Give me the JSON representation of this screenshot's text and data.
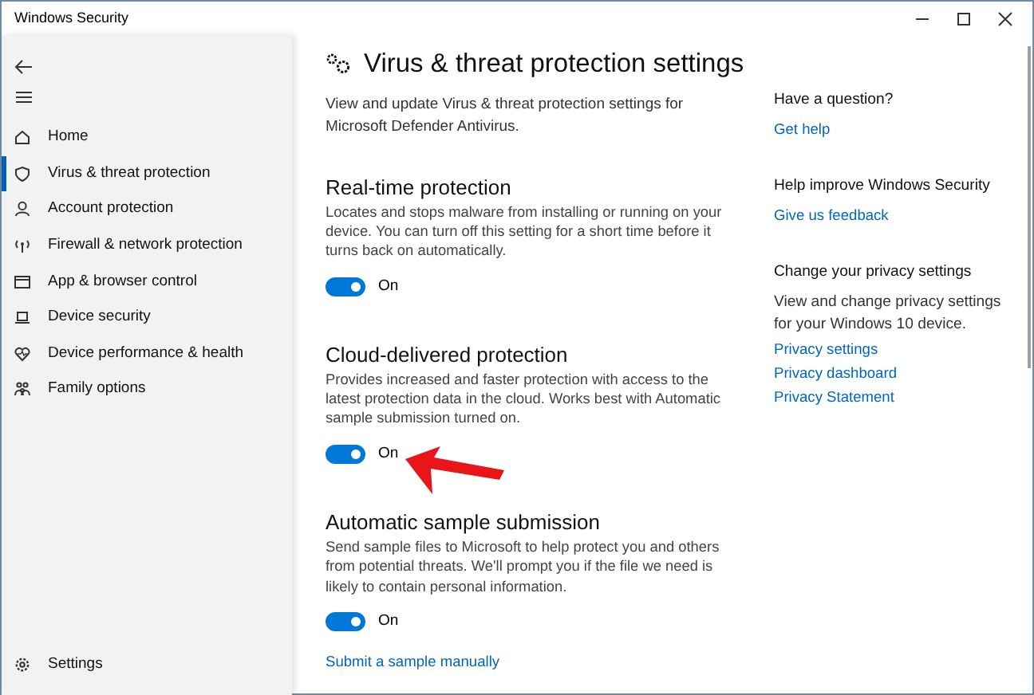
{
  "window": {
    "title": "Windows Security"
  },
  "sidebar": {
    "items": [
      {
        "label": "Home",
        "selected": false
      },
      {
        "label": "Virus & threat protection",
        "selected": true
      },
      {
        "label": "Account protection",
        "selected": false
      },
      {
        "label": "Firewall & network protection",
        "selected": false
      },
      {
        "label": "App & browser control",
        "selected": false
      },
      {
        "label": "Device security",
        "selected": false
      },
      {
        "label": "Device performance & health",
        "selected": false
      },
      {
        "label": "Family options",
        "selected": false
      }
    ],
    "settings": {
      "label": "Settings"
    }
  },
  "main": {
    "title": "Virus & threat protection settings",
    "description": "View and update Virus & threat protection settings for Microsoft Defender Antivirus.",
    "sections": [
      {
        "heading": "Real-time protection",
        "description": "Locates and stops malware from installing or running on your device. You can turn off this setting for a short time before it turns back on automatically.",
        "toggle": {
          "on": true,
          "label": "On"
        }
      },
      {
        "heading": "Cloud-delivered protection",
        "description": "Provides increased and faster protection with access to the latest protection data in the cloud. Works best with Automatic sample submission turned on.",
        "toggle": {
          "on": true,
          "label": "On"
        }
      },
      {
        "heading": "Automatic sample submission",
        "description": "Send sample files to Microsoft to help protect you and others from potential threats. We'll prompt you if the file we need is likely to contain personal information.",
        "toggle": {
          "on": true,
          "label": "On"
        },
        "link": "Submit a sample manually"
      }
    ]
  },
  "aside": [
    {
      "heading": "Have a question?",
      "links": [
        "Get help"
      ]
    },
    {
      "heading": "Help improve Windows Security",
      "links": [
        "Give us feedback"
      ]
    },
    {
      "heading": "Change your privacy settings",
      "description": "View and change privacy settings for your Windows 10 device.",
      "links": [
        "Privacy settings",
        "Privacy dashboard",
        "Privacy Statement"
      ]
    }
  ]
}
